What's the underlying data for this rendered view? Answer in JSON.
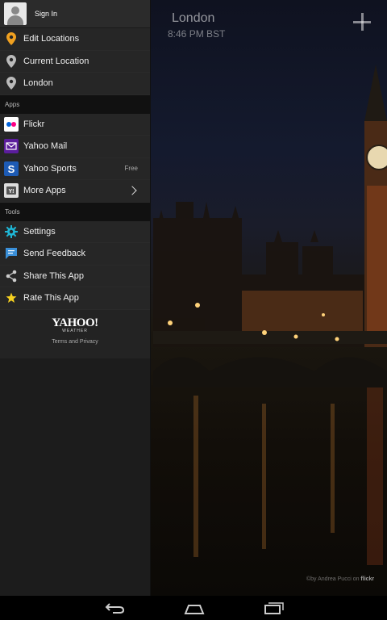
{
  "background": {
    "city": "London",
    "time": "8:46 PM BST",
    "photo_credit_prefix": "©by Andrea Pucci on ",
    "photo_credit_brand": "flickr"
  },
  "drawer": {
    "signin_label": "Sign In",
    "locations": [
      {
        "label": "Edit Locations",
        "icon": "pin-orange-icon"
      },
      {
        "label": "Current Location",
        "icon": "location-pin-icon"
      },
      {
        "label": "London",
        "icon": "location-pin-icon"
      }
    ],
    "apps_header": "Apps",
    "apps": [
      {
        "label": "Flickr",
        "icon": "flickr-icon",
        "badge": ""
      },
      {
        "label": "Yahoo Mail",
        "icon": "yahoo-mail-icon",
        "badge": ""
      },
      {
        "label": "Yahoo Sports",
        "icon": "yahoo-sports-icon",
        "badge": "Free"
      },
      {
        "label": "More Apps",
        "icon": "yahoo-apps-icon",
        "badge": ""
      }
    ],
    "tools_header": "Tools",
    "tools": [
      {
        "label": "Settings",
        "icon": "gear-icon"
      },
      {
        "label": "Send Feedback",
        "icon": "chat-bubble-icon"
      },
      {
        "label": "Share This App",
        "icon": "share-icon"
      },
      {
        "label": "Rate This App",
        "icon": "star-icon"
      }
    ],
    "footer": {
      "logo": "YAHOO!",
      "logo_sub": "WEATHER",
      "terms": "Terms and Privacy"
    }
  },
  "colors": {
    "accent_orange": "#f0a020",
    "yahoo_purple": "#5b1d9c",
    "sports_blue": "#1d5bb5",
    "settings_teal": "#1fb6d5",
    "feedback_blue": "#3a8fd8",
    "star_yellow": "#f5d020"
  }
}
